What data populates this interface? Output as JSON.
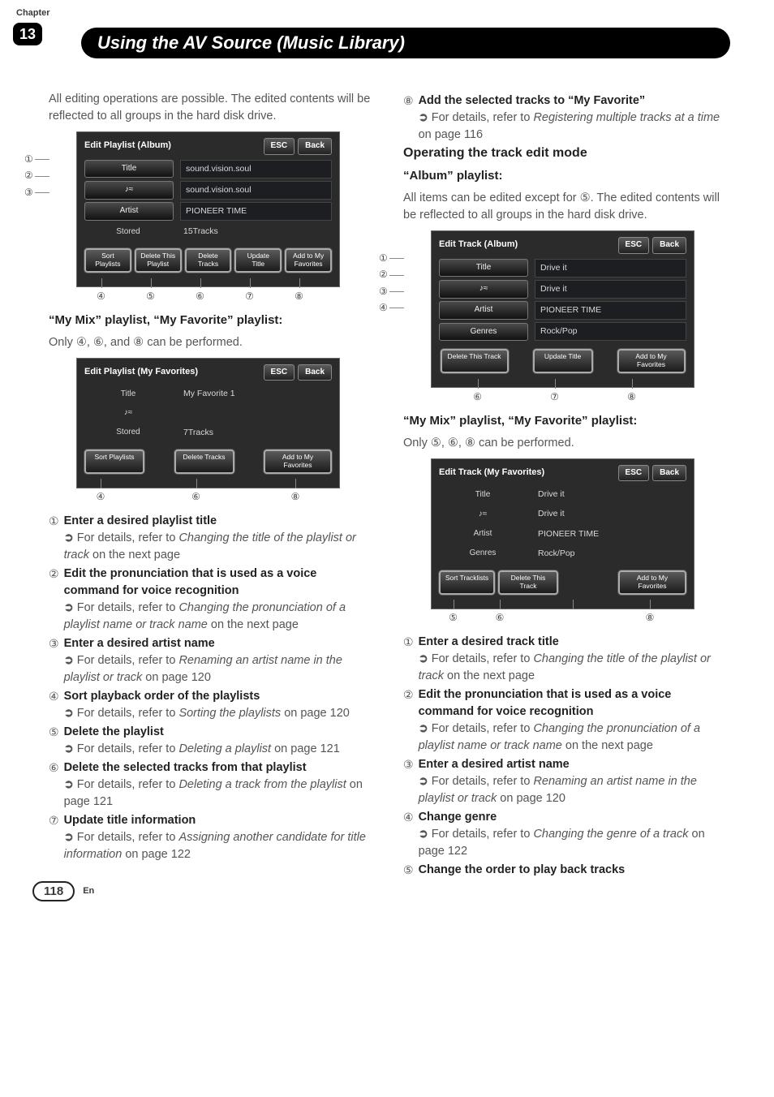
{
  "chapter": {
    "label": "Chapter",
    "number": "13"
  },
  "page_title": "Using the AV Source (Music Library)",
  "left": {
    "intro": "All editing operations are possible. The edited contents will be reflected to all groups in the hard disk drive.",
    "shot_album": {
      "header": "Edit Playlist (Album)",
      "esc": "ESC",
      "back": "Back",
      "rows": [
        {
          "label": "Title",
          "value": "sound.vision.soul"
        },
        {
          "label": "♪≈",
          "value": "sound.vision.soul"
        },
        {
          "label": "Artist",
          "value": "PIONEER TIME"
        },
        {
          "label": "Stored",
          "value": "15Tracks"
        }
      ],
      "buttons": [
        "Sort\nPlaylists",
        "Delete\nThis Playlist",
        "Delete\nTracks",
        "Update\nTitle",
        "Add to\nMy Favorites"
      ],
      "left_callouts": [
        "①",
        "②",
        "③"
      ],
      "bottom_callouts": [
        "④",
        "⑤",
        "⑥",
        "⑦",
        "⑧"
      ]
    },
    "mymix_heading": "“My Mix” playlist, “My Favorite” playlist:",
    "mymix_text": "Only ④, ⑥, and ⑧ can be performed.",
    "shot_fav": {
      "header": "Edit Playlist (My Favorites)",
      "esc": "ESC",
      "back": "Back",
      "rows": [
        {
          "label": "Title",
          "value": "My Favorite 1"
        },
        {
          "label": "♪≈",
          "value": ""
        },
        {
          "label": "Stored",
          "value": "7Tracks"
        }
      ],
      "buttons_left": "Sort\nPlaylists",
      "buttons_mid": "Delete\nTracks",
      "buttons_right": "Add to\nMy Favorites",
      "bottom_callouts": [
        "④",
        "⑥",
        "⑧"
      ]
    },
    "items": [
      {
        "n": "①",
        "title": "Enter a desired playlist title",
        "ref_pre": "For details, refer to ",
        "ref_it": "Changing the title of the playlist or track",
        "ref_post": " on the next page"
      },
      {
        "n": "②",
        "title": "Edit the pronunciation that is used as a voice command for voice recognition",
        "ref_pre": "For details, refer to ",
        "ref_it": "Changing the pronunciation of a playlist name or track name",
        "ref_post": " on the next page"
      },
      {
        "n": "③",
        "title": "Enter a desired artist name",
        "ref_pre": "For details, refer to ",
        "ref_it": "Renaming an artist name in the playlist or track",
        "ref_post": " on page 120"
      },
      {
        "n": "④",
        "title": "Sort playback order of the playlists",
        "ref_pre": "For details, refer to ",
        "ref_it": "Sorting the playlists",
        "ref_post": " on page 120"
      },
      {
        "n": "⑤",
        "title": "Delete the playlist",
        "ref_pre": "For details, refer to ",
        "ref_it": "Deleting a playlist",
        "ref_post": " on page 121"
      },
      {
        "n": "⑥",
        "title": "Delete the selected tracks from that playlist",
        "ref_pre": "For details, refer to ",
        "ref_it": "Deleting a track from the playlist",
        "ref_post": " on page 121"
      },
      {
        "n": "⑦",
        "title": "Update title information",
        "ref_pre": "For details, refer to ",
        "ref_it": "Assigning another candidate for title information",
        "ref_post": " on page 122"
      }
    ]
  },
  "right": {
    "item8": {
      "n": "⑧",
      "title": "Add the selected tracks to “My Favorite”",
      "ref_pre": "For details, refer to ",
      "ref_it": "Registering multiple tracks at a time",
      "ref_post": " on page 116"
    },
    "section_heading": "Operating the track edit mode",
    "album_heading": "“Album” playlist:",
    "album_text": "All items can be edited except for ⑤. The edited contents will be reflected to all groups in the hard disk drive.",
    "shot_track_album": {
      "header": "Edit Track (Album)",
      "esc": "ESC",
      "back": "Back",
      "rows": [
        {
          "label": "Title",
          "value": "Drive it"
        },
        {
          "label": "♪≈",
          "value": "Drive it"
        },
        {
          "label": "Artist",
          "value": "PIONEER TIME"
        },
        {
          "label": "Genres",
          "value": "Rock/Pop"
        }
      ],
      "buttons": [
        "Delete\nThis Track",
        "Update\nTitle",
        "Add to\nMy Favorites"
      ],
      "left_callouts": [
        "①",
        "②",
        "③",
        "④"
      ],
      "bottom_callouts": [
        "⑥",
        "⑦",
        "⑧"
      ]
    },
    "mymix_heading": "“My Mix” playlist, “My Favorite” playlist:",
    "mymix_text": "Only ⑤, ⑥, ⑧ can be performed.",
    "shot_track_fav": {
      "header": "Edit Track (My Favorites)",
      "esc": "ESC",
      "back": "Back",
      "rows": [
        {
          "label": "Title",
          "value": "Drive it"
        },
        {
          "label": "♪≈",
          "value": "Drive it"
        },
        {
          "label": "Artist",
          "value": "PIONEER TIME"
        },
        {
          "label": "Genres",
          "value": "Rock/Pop"
        }
      ],
      "buttons": [
        "Sort\nTracklists",
        "Delete\nThis Track",
        "Add to\nMy Favorites"
      ],
      "bottom_callouts": [
        "⑤",
        "⑥",
        "⑧"
      ]
    },
    "items": [
      {
        "n": "①",
        "title": "Enter a desired track title",
        "ref_pre": "For details, refer to ",
        "ref_it": "Changing the title of the playlist or track",
        "ref_post": " on the next page"
      },
      {
        "n": "②",
        "title": "Edit the pronunciation that is used as a voice command for voice recognition",
        "ref_pre": "For details, refer to ",
        "ref_it": "Changing the pronunciation of a playlist name or track name",
        "ref_post": " on the next page"
      },
      {
        "n": "③",
        "title": "Enter a desired artist name",
        "ref_pre": "For details, refer to ",
        "ref_it": "Renaming an artist name in the playlist or track",
        "ref_post": " on page 120"
      },
      {
        "n": "④",
        "title": "Change genre",
        "ref_pre": "For details, refer to ",
        "ref_it": "Changing the genre of a track",
        "ref_post": " on page 122"
      },
      {
        "n": "⑤",
        "title": "Change the order to play back tracks",
        "ref_pre": "",
        "ref_it": "",
        "ref_post": ""
      }
    ]
  },
  "footer": {
    "page": "118",
    "lang": "En"
  }
}
